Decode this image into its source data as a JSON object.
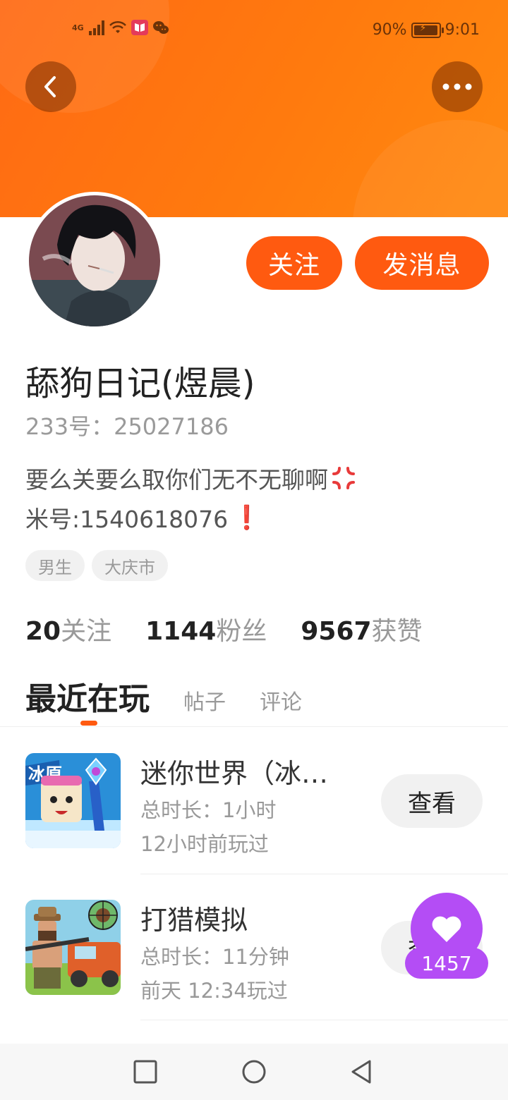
{
  "status_bar": {
    "network": "4G",
    "battery": "90%",
    "time": "9:01"
  },
  "header": {
    "back_icon": "chevron-left-icon",
    "more_icon": "more-dots-icon"
  },
  "profile": {
    "follow_label": "关注",
    "message_label": "发消息",
    "name": "舔狗日记(煜晨)",
    "uid": "233号：25027186",
    "bio_line1": "要么关要么取你们无不无聊啊",
    "bio_line2": "米号:1540618076",
    "bio_emoji2": "❗",
    "tags": [
      "男生",
      "大庆市"
    ],
    "stats": [
      {
        "num": "20",
        "label": "关注"
      },
      {
        "num": "1144",
        "label": "粉丝"
      },
      {
        "num": "9567",
        "label": "获赞"
      }
    ]
  },
  "tabs": [
    "最近在玩",
    "帖子",
    "评论"
  ],
  "games": [
    {
      "title": "迷你世界（冰…",
      "duration": "总时长：1小时",
      "last_played": "12小时前玩过",
      "button": "查看",
      "icon_text": "冰原"
    },
    {
      "title": "打猎模拟",
      "duration": "总时长：11分钟",
      "last_played": "前天 12:34玩过",
      "button": "查看"
    }
  ],
  "like": {
    "count": "1457"
  },
  "colors": {
    "accent": "#ff5a10",
    "header": "#ff7a0e",
    "like": "#b44df5"
  }
}
